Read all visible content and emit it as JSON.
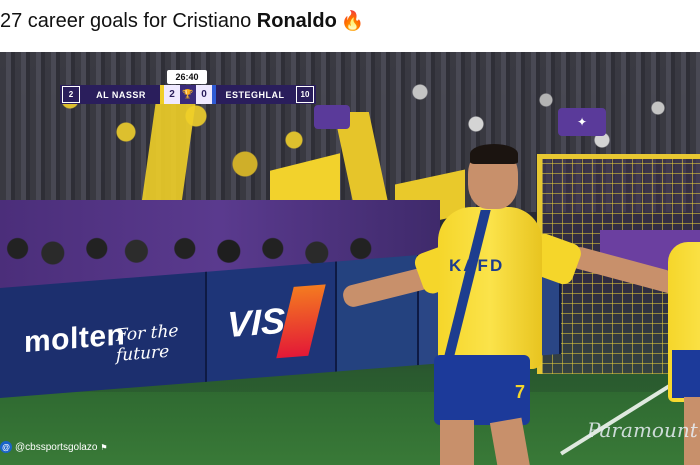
{
  "caption": {
    "prefix": "27 career goals for Cristiano ",
    "name": "Ronaldo",
    "emoji": "🔥"
  },
  "scoreboard": {
    "clock": "26:40",
    "home_rank": "2",
    "home_team": "AL NASSR",
    "home_score": "2",
    "away_score": "0",
    "away_team": "ESTEGHLAL",
    "away_rank": "10",
    "trophy_icon": "🏆"
  },
  "jersey": {
    "sponsor": "KAFD",
    "number": "7"
  },
  "ads": {
    "molten": "molten",
    "molten_slogan": "For the future",
    "visa": "VISA"
  },
  "watermarks": {
    "left_handle": "@cbssportsgolazo",
    "right_brand": "Paramount+"
  },
  "colors": {
    "home_yellow": "#f0cf28",
    "away_blue": "#2e5bd6",
    "scoreboard_purple": "#2a1e5c"
  }
}
